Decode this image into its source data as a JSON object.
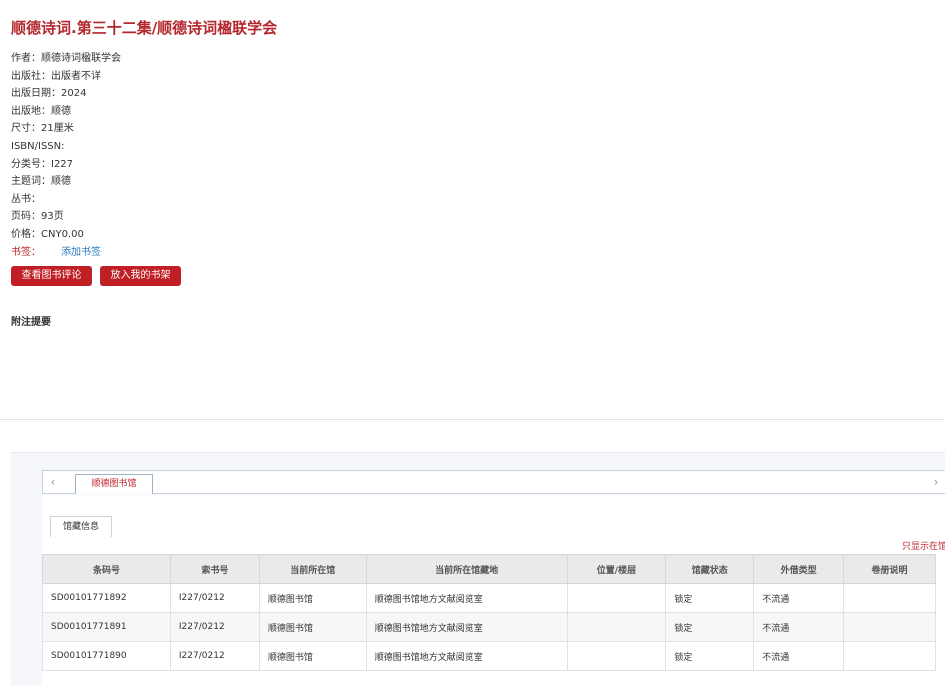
{
  "book": {
    "title": "顺德诗词.第三十二集/顺德诗词楹联学会",
    "meta": [
      {
        "label": "作者：",
        "value": "顺德诗词楹联学会"
      },
      {
        "label": "出版社：",
        "value": "出版者不详"
      },
      {
        "label": "出版日期：",
        "value": "2024"
      },
      {
        "label": "出版地：",
        "value": "顺德"
      },
      {
        "label": "尺寸：",
        "value": "21厘米"
      },
      {
        "label": "ISBN/ISSN:",
        "value": ""
      },
      {
        "label": "分类号：",
        "value": "I227"
      },
      {
        "label": "主题词：",
        "value": "顺德"
      },
      {
        "label": "丛书：",
        "value": ""
      },
      {
        "label": "页码：",
        "value": "93页"
      },
      {
        "label": "价格：",
        "value": "CNY0.00"
      }
    ],
    "bookmark_label": "书签：",
    "bookmark_add": "添加书签"
  },
  "actions": {
    "view_reviews": "查看图书评论",
    "add_shelf": "放入我的书架"
  },
  "notes_heading": "附注提要",
  "holdings": {
    "nav_left": "‹",
    "nav_right": "›",
    "library_tab": "顺德图书馆",
    "sub_tab": "馆藏信息",
    "only_link": "只显示在馆",
    "headers": [
      "条码号",
      "索书号",
      "当前所在馆",
      "当前所在馆藏地",
      "位置/楼层",
      "馆藏状态",
      "外借类型",
      "卷册说明"
    ],
    "rows": [
      [
        "SD00101771892",
        "I227/0212",
        "顺德图书馆",
        "顺德图书馆地方文献阅览室",
        "",
        "锁定",
        "不流通",
        ""
      ],
      [
        "SD00101771891",
        "I227/0212",
        "顺德图书馆",
        "顺德图书馆地方文献阅览室",
        "",
        "锁定",
        "不流通",
        ""
      ],
      [
        "SD00101771890",
        "I227/0212",
        "顺德图书馆",
        "顺德图书馆地方文献阅览室",
        "",
        "锁定",
        "不流通",
        ""
      ]
    ]
  }
}
